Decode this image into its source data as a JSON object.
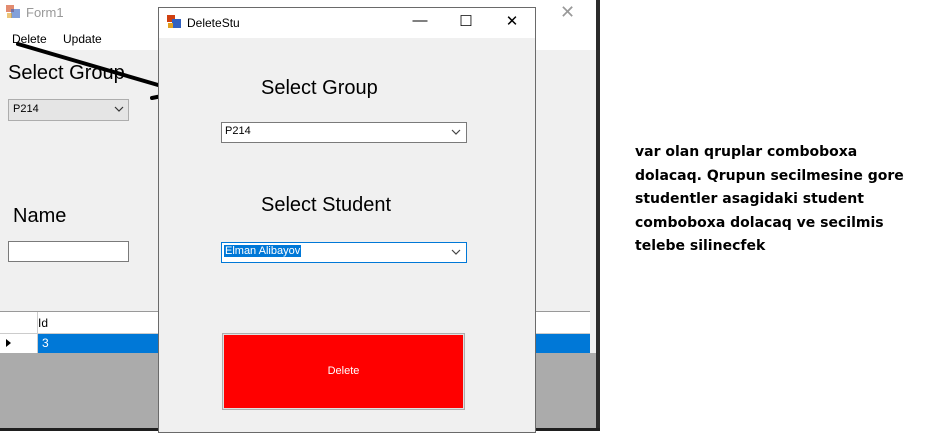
{
  "form1": {
    "title": "Form1",
    "close_symbol": "✕",
    "menu": [
      "Delete",
      "Update"
    ],
    "select_group_label": "Select Group",
    "group_value": "P214",
    "name_label": "Name",
    "name_value": "",
    "grid": {
      "columns": [
        "Id"
      ],
      "rows": [
        [
          "3"
        ]
      ]
    }
  },
  "dialog": {
    "title": "DeleteStu",
    "minimize_symbol": "—",
    "maximize_symbol": "☐",
    "close_symbol": "✕",
    "select_group_label": "Select Group",
    "group_value": "P214",
    "select_student_label": "Select Student",
    "student_value": "Elman Alibayov",
    "delete_label": "Delete",
    "delete_color": "#ff0000"
  },
  "annotation": "var olan qruplar comboboxa\ndolacaq. Qrupun secilmesine gore\nstudentler asagidaki student\ncomboboxa dolacaq ve secilmis\ntelebe silinecfek",
  "icons": [
    "form-app-icon",
    "dropdown-arrow-icon",
    "row-pointer-icon",
    "hand-drawn-arrow"
  ]
}
